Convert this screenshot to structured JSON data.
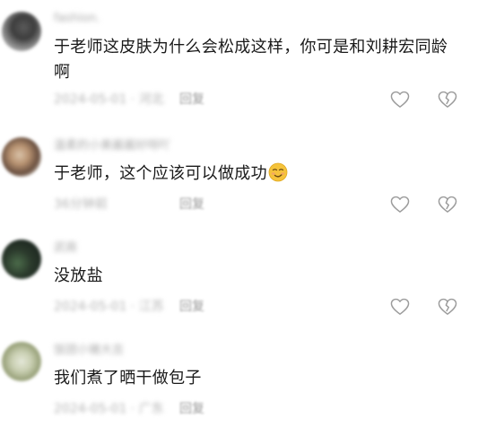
{
  "comments": [
    {
      "username": "fashion.",
      "text": "于老师这皮肤为什么会松成这样，你可是和刘耕宏同龄啊",
      "meta": "2024-05-01 · 河北",
      "reply": "回复"
    },
    {
      "username": "温柔的小美酱酱好呀吖",
      "text": "于老师，这个应该可以做成功",
      "emoji": "smirk-emoji",
      "meta": "36分钟前",
      "reply": "回复"
    },
    {
      "username": "武商",
      "text": "没放盐",
      "meta": "2024-05-01 · 江苏",
      "reply": "回复"
    },
    {
      "username": "饭团小猪大吉",
      "text": "我们煮了晒干做包子",
      "meta": "2024-05-01 · 广东",
      "reply": "回复"
    }
  ],
  "icons": {
    "like": "heart-outline-icon",
    "dislike": "broken-heart-icon"
  },
  "colors": {
    "text": "#1a1a1a",
    "meta": "#b3b3b3",
    "icon": "#9b9b9b"
  }
}
